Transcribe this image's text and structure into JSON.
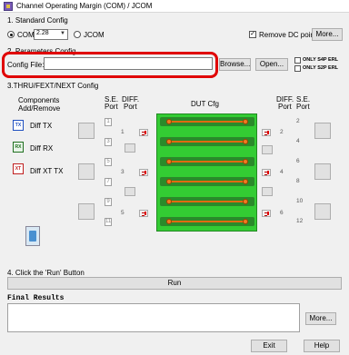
{
  "window": {
    "title": "Channel Operating Margin (COM) / JCOM"
  },
  "standard_config": {
    "heading": "1. Standard Config",
    "com_label": "COM",
    "version_value": "2.28",
    "jcom_label": "JCOM",
    "remove_dc_label": "Remove DC point",
    "more_label": "More..."
  },
  "params_config": {
    "heading": "2. Parameters Config",
    "config_file_label": "Config File:",
    "config_file_value": "",
    "browse_label": "Browse...",
    "open_label": "Open...",
    "only_s4p_label": "ONLY S4P ERL",
    "only_s2p_label": "ONLY S2P ERL"
  },
  "thru_config": {
    "heading": "3.THRU/FEXT/NEXT Config",
    "components_heading_1": "Components",
    "components_heading_2": "Add/Remove",
    "se_port_label_1": "S.E.",
    "se_port_label_2": "Port",
    "diff_port_label_1": "DIFF.",
    "diff_port_label_2": "Port",
    "dut_label": "DUT Cfg",
    "components": [
      {
        "label": "Diff TX",
        "icon": "TX"
      },
      {
        "label": "Diff RX",
        "icon": "RX"
      },
      {
        "label": "Diff XT TX",
        "icon": "XT"
      }
    ],
    "left_se_ports": [
      "1",
      "3",
      "5",
      "7",
      "9",
      "11"
    ],
    "left_diff_ports": [
      "1",
      "3",
      "5"
    ],
    "right_diff_ports": [
      "2",
      "4",
      "6"
    ],
    "right_se_ports": [
      "2",
      "4",
      "6",
      "8",
      "10",
      "12"
    ]
  },
  "run": {
    "heading": "4. Click the 'Run' Button",
    "run_label": "Run"
  },
  "final_results": {
    "heading": "Final Results",
    "more_label": "More..."
  },
  "footer": {
    "exit_label": "Exit",
    "help_label": "Help"
  },
  "colors": {
    "highlight": "#e00000",
    "dut_green": "#33cc33",
    "trace_orange": "#e06a10"
  }
}
